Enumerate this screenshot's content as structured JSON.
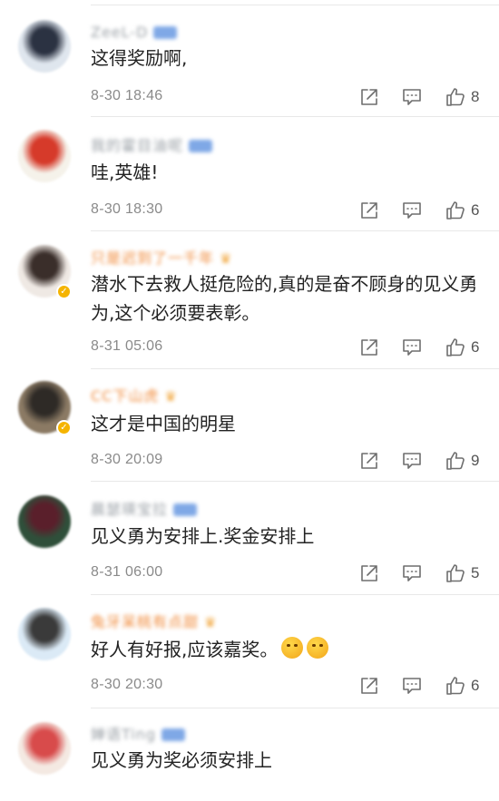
{
  "comments": [
    {
      "user": "ZeeL-D",
      "badge": "vip",
      "text": "这得奖励啊,",
      "time": "8-30 18:46",
      "likes": "8",
      "avatar_colors": [
        "#dfe6ee",
        "#2b3242"
      ]
    },
    {
      "user": "我的霍目油呢",
      "badge": "vip",
      "text": "哇,英雄!",
      "time": "8-30 18:30",
      "likes": "6",
      "avatar_colors": [
        "#f5f2ea",
        "#d63a2a"
      ]
    },
    {
      "user": "只是迟到了一千年",
      "badge": "crown",
      "text": "潜水下去救人挺危险的,真的是奋不顾身的见义勇为,这个必须要表彰。",
      "time": "8-31 05:06",
      "likes": "6",
      "avatar_colors": [
        "#efe9e4",
        "#3a2e2a"
      ],
      "verified": true
    },
    {
      "user": "CC下山虎",
      "badge": "crown",
      "text": "这才是中国的明星",
      "time": "8-30 20:09",
      "likes": "9",
      "avatar_colors": [
        "#8b7a64",
        "#2e2a26"
      ],
      "verified": true
    },
    {
      "user": "晨瑟瑛宝拉",
      "badge": "vip",
      "text": "见义勇为安排上.奖金安排上",
      "time": "8-31 06:00",
      "likes": "5",
      "avatar_colors": [
        "#2f4f3a",
        "#5a1f2b"
      ]
    },
    {
      "user": "兔牙呆桃有点甜",
      "badge": "crown",
      "text": "好人有好报,应该嘉奖。",
      "time": "8-30 20:30",
      "likes": "6",
      "avatar_colors": [
        "#dbeaf6",
        "#3a3a3a"
      ],
      "emoji_count": 2,
      "emoji_name": "face-emoji"
    },
    {
      "user": "婵语Ting",
      "badge": "vip",
      "text": "见义勇为奖必须安排上",
      "avatar_colors": [
        "#f4e9e2",
        "#d84b4b"
      ]
    }
  ],
  "icons": {
    "share": "share-icon",
    "reply": "reply-icon",
    "like": "thumbs-up-icon"
  },
  "colors": {
    "username_vip": "#9aa0a6",
    "username_crown": "#f08a3a",
    "timestamp": "#8a8a8a",
    "separator": "#e8e8e8"
  }
}
